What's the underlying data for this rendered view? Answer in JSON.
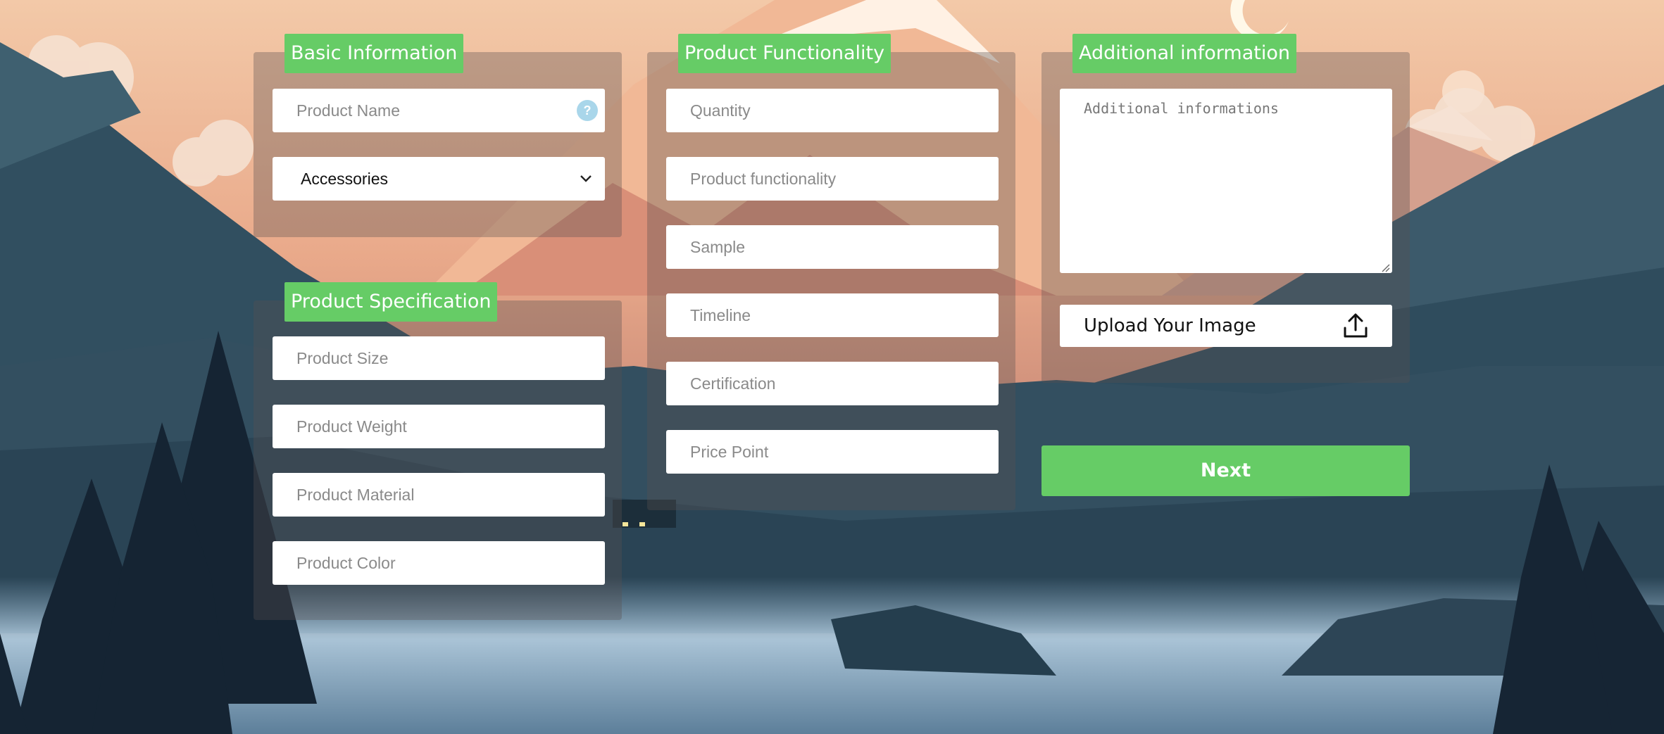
{
  "sections": {
    "basic": {
      "title": "Basic Information",
      "product_name_placeholder": "Product Name",
      "help_symbol": "?",
      "category_selected": "Accessories"
    },
    "specification": {
      "title": "Product Specification",
      "size_placeholder": "Product Size",
      "weight_placeholder": "Product Weight",
      "material_placeholder": "Product Material",
      "color_placeholder": "Product Color"
    },
    "functionality": {
      "title": "Product Functionality",
      "quantity_placeholder": "Quantity",
      "functionality_placeholder": "Product functionality",
      "sample_placeholder": "Sample",
      "timeline_placeholder": "Timeline",
      "certification_placeholder": "Certification",
      "price_point_placeholder": "Price Point"
    },
    "additional": {
      "title": "Additional information",
      "notes_placeholder": "Additional informations",
      "upload_label": "Upload Your Image"
    }
  },
  "actions": {
    "next_label": "Next"
  },
  "icons": {
    "help": "question-mark-icon",
    "dropdown": "chevron-down-icon",
    "upload": "upload-icon"
  },
  "colors": {
    "accent_green": "#66cc66",
    "help_blue": "#a9d6ea"
  }
}
